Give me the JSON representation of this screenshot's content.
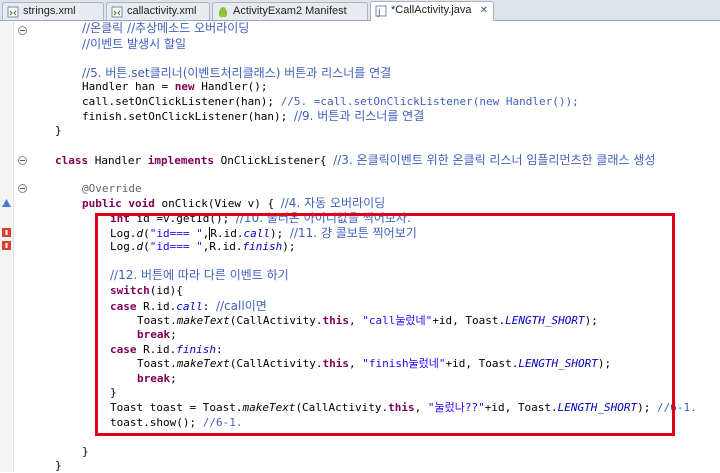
{
  "tabs": [
    {
      "label": "strings.xml",
      "active": false
    },
    {
      "label": "callactivity.xml",
      "active": false
    },
    {
      "label": "ActivityExam2 Manifest",
      "active": false
    },
    {
      "label": "*CallActivity.java",
      "active": true,
      "close": "✕"
    }
  ],
  "code": {
    "l1": {
      "t": "//온클릭 //추상메소드 오버라이딩"
    },
    "l2": {
      "t": "//이벤트 발생시 할일"
    },
    "l3": {
      "t": "//5. 버튼.set클리너(이벤트처리클래스) 버튼과 리스너를 연결"
    },
    "l4": {
      "a": "Handler han = ",
      "b": "new",
      "c": " Handler();"
    },
    "l5": {
      "a": "call.setOnClickListener(han); ",
      "b": "//5. =call.setOnClickListener(new Handler());"
    },
    "l6": {
      "a": "finish.setOnClickListener(han); ",
      "b": "//9. 버튼과 리스너를 연결"
    },
    "l7": {
      "t": "}"
    },
    "l8": {
      "a": "class",
      "b": " Handler ",
      "c": "implements",
      "d": " OnClickListener{ ",
      "e": "//3. 온클릭이벤트 위한 온클릭 리스너 임플리먼츠한 클래스 생성"
    },
    "l9": {
      "t": "@Override"
    },
    "l10": {
      "a": "public",
      "b": "void",
      "c": " onClick(View v) { ",
      "d": "//4. 자동 오버라이딩"
    },
    "l11": {
      "a": "int",
      "b": " id =v.getId(); ",
      "c": "//10. 눌러온 아이디값을 찍어보자."
    },
    "l12": {
      "a": "Log.",
      "b": "d",
      "c": "(",
      "d": "\"id=== \"",
      "e": ",",
      "f": "R.id.",
      "g": "call",
      "h": "); ",
      "i": "//11. 걍 콜보튼 찍어보기"
    },
    "l13": {
      "a": "Log.",
      "b": "d",
      "c": "(",
      "d": "\"id=== \"",
      "e": ",",
      "f": "R.id.",
      "g": "finish",
      "h": ");"
    },
    "l14": {
      "t": "//12. 버튼에 따라 다른 이벤트 하기"
    },
    "l15": {
      "a": "switch",
      "b": "(id){"
    },
    "l16": {
      "a": "case",
      "b": " R.id.",
      "c": "call",
      "d": ": ",
      "e": "//call이면"
    },
    "l17": {
      "a": "Toast.",
      "b": "makeText",
      "c": "(CallActivity.",
      "d": "this",
      "e": ", ",
      "f": "\"call눌렀네\"",
      "g": "+id, Toast.",
      "h": "LENGTH_SHORT",
      "i": ");"
    },
    "l18": {
      "a": "break",
      "b": ";"
    },
    "l19": {
      "a": "case",
      "b": " R.id.",
      "c": "finish",
      "d": ":"
    },
    "l20": {
      "a": "Toast.",
      "b": "makeText",
      "c": "(CallActivity.",
      "d": "this",
      "e": ", ",
      "f": "\"finish눌렀네\"",
      "g": "+id, Toast.",
      "h": "LENGTH_SHORT",
      "i": ");"
    },
    "l21": {
      "a": "break",
      "b": ";"
    },
    "l22": {
      "t": "}"
    },
    "l23": {
      "a": "Toast toast = Toast.",
      "b": "makeText",
      "c": "(CallActivity.",
      "d": "this",
      "e": ", ",
      "f": "\"눌렀나??\"",
      "g": "+id, Toast.",
      "h": "LENGTH_SHORT",
      "i": "); ",
      "j": "//6-1."
    },
    "l24": {
      "a": "toast.show(); ",
      "b": "//6-1."
    },
    "l25": {
      "t": "}"
    },
    "l26": {
      "t": "}"
    }
  },
  "colors": {
    "keyword": "#7f0055",
    "comment": "#3f5fbf",
    "string": "#2a00ff",
    "field": "#0000c0",
    "highlight_box": "#e0001a"
  }
}
